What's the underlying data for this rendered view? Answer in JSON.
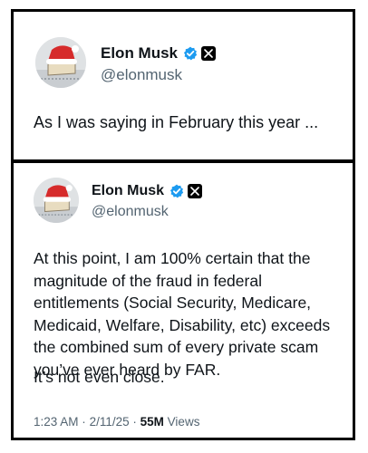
{
  "quote_tweet": {
    "author_name": "Elon Musk",
    "handle": "@elonmusk",
    "text": "As I was saying in February this year ..."
  },
  "original_tweet": {
    "author_name": "Elon Musk",
    "handle": "@elonmusk",
    "text_paragraph_1": "At this point, I am 100% certain that the magnitude of the fraud in federal entitlements (Social Security, Medicare, Medicaid, Welfare, Disability, etc) exceeds the combined sum of every private scam you’ve ever heard by FAR.",
    "text_paragraph_2": "It’s not even close.",
    "time": "1:23 AM",
    "separator": "·",
    "date": "2/11/25",
    "views_count": "55M",
    "views_label": "Views"
  },
  "icons": [
    "avatar",
    "verified-badge-icon",
    "x-logo-icon"
  ],
  "colors": {
    "verified_blue": "#1d9bf0",
    "secondary_text": "#536471",
    "border": "#000000"
  }
}
